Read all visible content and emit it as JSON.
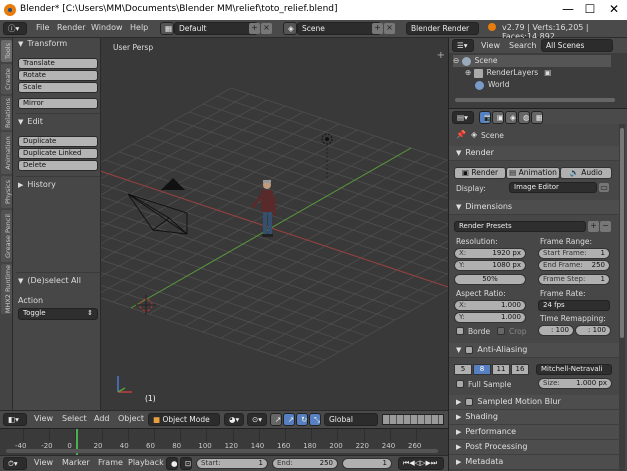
{
  "window": {
    "title": "Blender* [C:\\Users\\MM\\Documents\\Blender MM\\relief\\toto_relief.blend]",
    "minimize": "—",
    "maximize": "☐",
    "close": "✕"
  },
  "info_header": {
    "menus": [
      "File",
      "Render",
      "Window",
      "Help"
    ],
    "screen_layout": "Default",
    "scene": "Scene",
    "engine": "Blender Render",
    "stats": "v2.79 | Verts:16,205 | Faces:14,892"
  },
  "tool_tabs": [
    "Tools",
    "Create",
    "Relations",
    "Animation",
    "Physics",
    "Grease Pencil",
    "MHX2 Runtime"
  ],
  "tools": {
    "transform_header": "Transform",
    "translate": "Translate",
    "rotate": "Rotate",
    "scale": "Scale",
    "mirror": "Mirror",
    "edit_header": "Edit",
    "duplicate": "Duplicate",
    "duplicate_linked": "Duplicate Linked",
    "delete": "Delete",
    "history_header": "History",
    "last_op_header": "(De)select All",
    "action_label": "Action",
    "action_value": "Toggle"
  },
  "viewport": {
    "label": "User Persp",
    "frame": "(1)",
    "colors": {
      "grid": "#555555",
      "x_axis": "#9a4040",
      "y_axis": "#5a9a3a",
      "background": "#393939"
    }
  },
  "viewport_header": {
    "menus": [
      "View",
      "Select",
      "Add",
      "Object"
    ],
    "mode": "Object Mode",
    "orientation": "Global"
  },
  "timeline": {
    "ticks": [
      "-40",
      "-20",
      "0",
      "20",
      "40",
      "60",
      "80",
      "100",
      "120",
      "140",
      "160",
      "180",
      "200",
      "220",
      "240",
      "260"
    ],
    "current_frame": 1,
    "menus": [
      "View",
      "Marker",
      "Frame",
      "Playback"
    ],
    "start_label": "Start:",
    "start_value": "1",
    "end_label": "End:",
    "end_value": "250",
    "frame_value": "1"
  },
  "outliner": {
    "view": "View",
    "search": "Search",
    "filter": "All Scenes",
    "items": [
      "Scene",
      "RenderLayers",
      "World"
    ]
  },
  "properties": {
    "scene_name": "Scene",
    "render_header": "Render",
    "render_btn": "Render",
    "animation_btn": "Animation",
    "audio_btn": "Audio",
    "display_label": "Display:",
    "display_value": "Image Editor",
    "dimensions_header": "Dimensions",
    "presets": "Render Presets",
    "resolution_label": "Resolution:",
    "res_x_k": "X:",
    "res_x": "1920 px",
    "res_y_k": "Y:",
    "res_y": "1080 px",
    "res_pct": "50%",
    "frame_range_label": "Frame Range:",
    "start_k": "Start Frame:",
    "start_v": "1",
    "end_k": "End Frame:",
    "end_v": "250",
    "step_k": "Frame Step:",
    "step_v": "1",
    "aspect_label": "Aspect Ratio:",
    "asp_x_k": "X:",
    "asp_x": "1.000",
    "asp_y_k": "Y:",
    "asp_y": "1.000",
    "frame_rate_label": "Frame Rate:",
    "fps": "24 fps",
    "remap_label": "Time Remapping:",
    "remap_old": ": 100",
    "remap_new": ": 100",
    "border": "Borde",
    "crop": "Crop",
    "aa_header": "Anti-Aliasing",
    "aa_samples": [
      "5",
      "8",
      "11",
      "16"
    ],
    "aa_filter": "Mitchell-Netravali",
    "full_sample": "Full Sample",
    "size_k": "Size:",
    "size_v": "1.000 px",
    "collapsed": [
      "Sampled Motion Blur",
      "Shading",
      "Performance",
      "Post Processing",
      "Metadata"
    ]
  }
}
